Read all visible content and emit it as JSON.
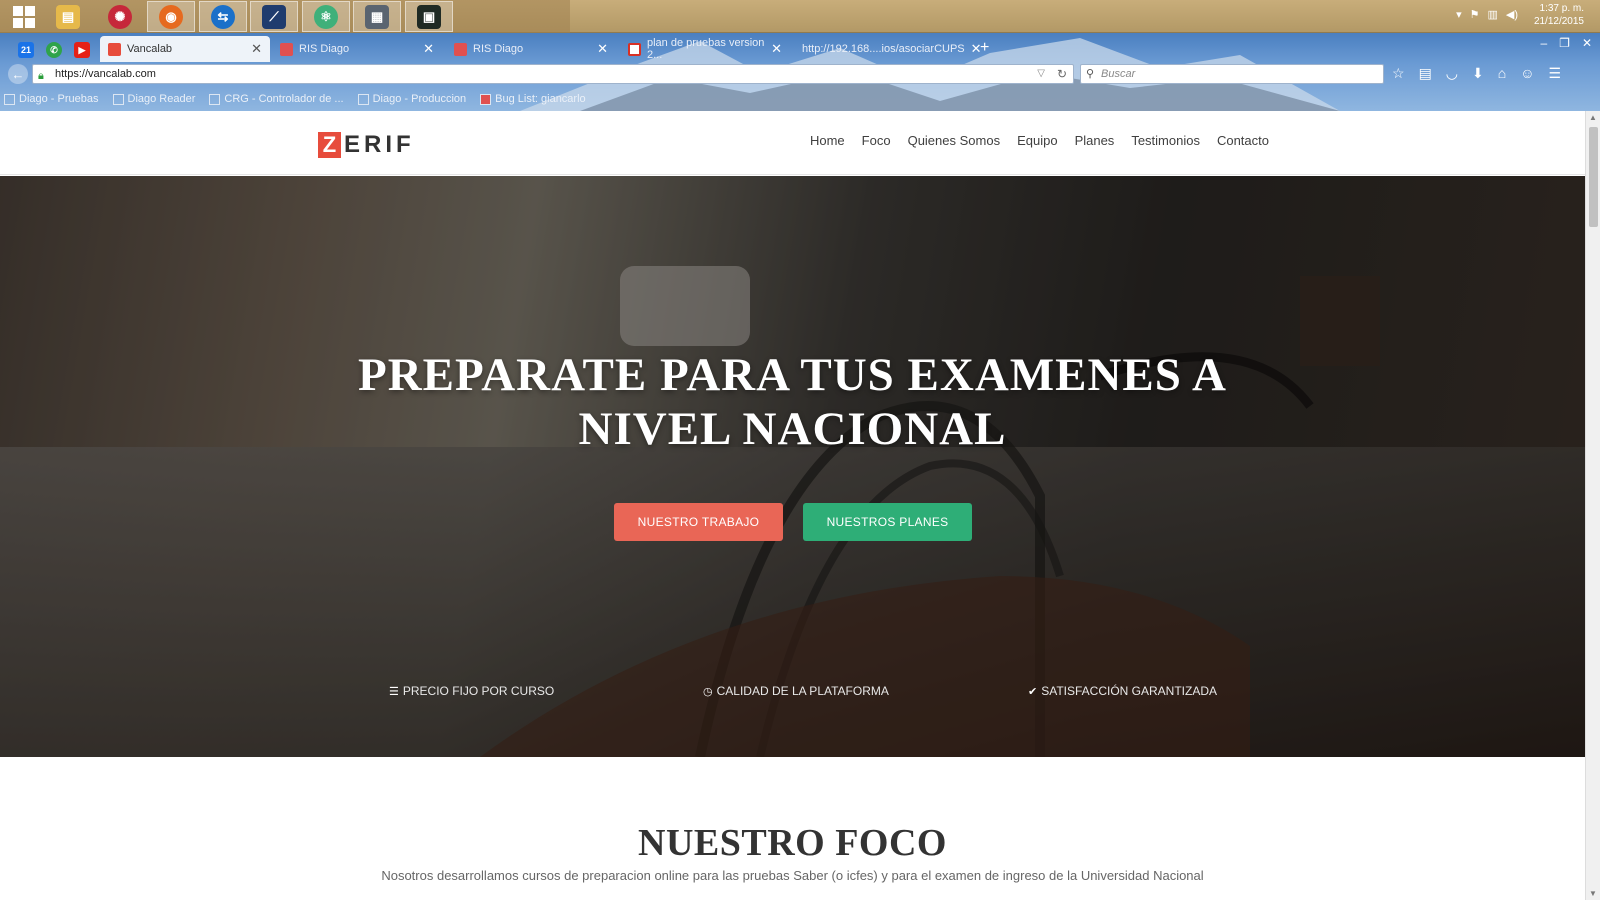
{
  "taskbar": {
    "clock_time": "1:37 p. m.",
    "clock_date": "21/12/2015",
    "apps": [
      "windows-start",
      "file-explorer",
      "app-red",
      "firefox",
      "teamviewer",
      "app-vs",
      "atom",
      "app-manager",
      "terminal"
    ]
  },
  "browser": {
    "tabs": [
      {
        "title": "Vancalab",
        "active": true
      },
      {
        "title": "RIS Diago",
        "active": false
      },
      {
        "title": "RIS Diago",
        "active": false
      },
      {
        "title": "plan de pruebas version 2...",
        "active": false
      },
      {
        "title": "http://192.168....ios/asociarCUPS",
        "active": false
      }
    ],
    "pinned": [
      "21"
    ],
    "url": "https://vancalab.com",
    "search_placeholder": "Buscar",
    "bookmarks": [
      "Diago - Pruebas",
      "Diago Reader",
      "CRG - Controlador de ...",
      "Diago - Produccion",
      "Bug List: giancarlo"
    ]
  },
  "site": {
    "logo_letter": "Z",
    "logo_rest": "ERIF",
    "menu": [
      "Home",
      "Foco",
      "Quienes Somos",
      "Equipo",
      "Planes",
      "Testimonios",
      "Contacto"
    ],
    "hero": {
      "title_line1": "PREPARATE PARA TUS EXAMENES A",
      "title_line2": "NIVEL NACIONAL",
      "btn_primary": "NUESTRO TRABAJO",
      "btn_secondary": "NUESTROS PLANES",
      "features": [
        "PRECIO FIJO POR CURSO",
        "CALIDAD DE LA PLATAFORMA",
        "SATISFACCIÓN GARANTIZADA"
      ]
    },
    "section": {
      "title": "NUESTRO FOCO",
      "subtitle": "Nosotros desarrollamos cursos de preparacion online para las pruebas Saber (o icfes) y para el examen de ingreso de la Universidad Nacional"
    }
  },
  "colors": {
    "accent_red": "#e96656",
    "accent_green": "#2eae77"
  }
}
